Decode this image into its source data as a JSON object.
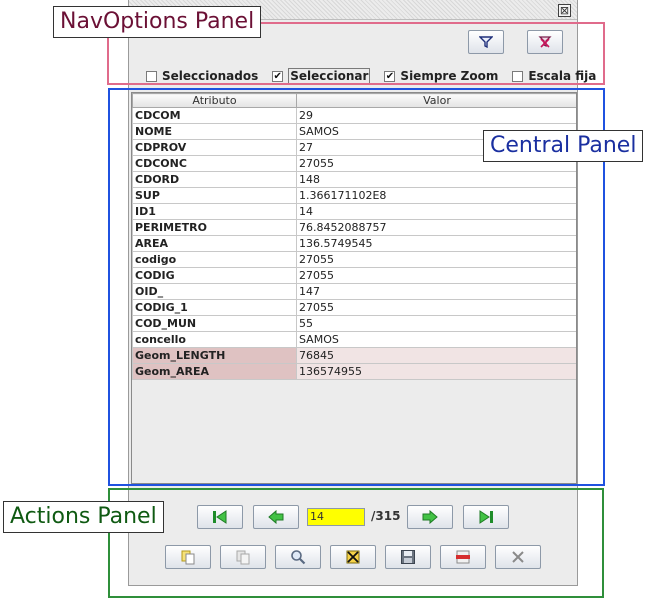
{
  "annotations": {
    "nav_options": "NavOptions Panel",
    "central": "Central Panel",
    "actions": "Actions Panel"
  },
  "window": {
    "close_glyph": "⊠"
  },
  "nav_options": {
    "checkboxes": [
      {
        "label": "Seleccionados",
        "checked": false
      },
      {
        "label": "Seleccionar",
        "checked": true
      },
      {
        "label": "Siempre Zoom",
        "checked": true
      },
      {
        "label": "Escala fija",
        "checked": false
      }
    ]
  },
  "table": {
    "headers": [
      "Atributo",
      "Valor"
    ],
    "rows": [
      [
        "CDCOM",
        "29"
      ],
      [
        "NOME",
        "SAMOS"
      ],
      [
        "CDPROV",
        "27"
      ],
      [
        "CDCONC",
        "27055"
      ],
      [
        "CDORD",
        "148"
      ],
      [
        "SUP",
        "1.366171102E8"
      ],
      [
        "ID1",
        "14"
      ],
      [
        "PERIMETRO",
        "76.8452088757"
      ],
      [
        "AREA",
        "136.5749545"
      ],
      [
        "codigo",
        "27055"
      ],
      [
        "CODIG",
        "27055"
      ],
      [
        "OID_",
        "147"
      ],
      [
        "CODIG_1",
        "27055"
      ],
      [
        "COD_MUN",
        "55"
      ],
      [
        "concello",
        "SAMOS"
      ],
      [
        "Geom_LENGTH",
        "76845"
      ],
      [
        "Geom_AREA",
        "136574955"
      ]
    ],
    "highlighted_rows": [
      15,
      16
    ]
  },
  "navigation": {
    "current_record": "14",
    "total": "/315"
  },
  "colors": {
    "record_input_bg": "#ffff00",
    "highlight_attr": "#dfc2c2",
    "highlight_value": "#f1e4e4"
  }
}
